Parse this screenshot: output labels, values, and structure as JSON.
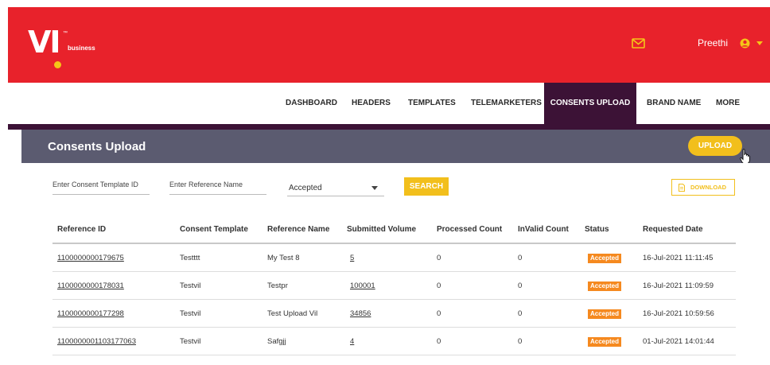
{
  "brand": {
    "mark": "VI",
    "tm": "™",
    "sub": "business"
  },
  "header": {
    "user_name": "Preethi",
    "mail_icon": "mail-icon",
    "user_icon": "user-circle-icon",
    "accent": "#f5c518",
    "bg": "#e8222b"
  },
  "nav": {
    "items": [
      {
        "label": "DASHBOARD"
      },
      {
        "label": "HEADERS"
      },
      {
        "label": "TEMPLATES"
      },
      {
        "label": "TELEMARKETERS"
      },
      {
        "label": "CONSENTS UPLOAD",
        "active": true
      },
      {
        "label": "BRAND NAME"
      },
      {
        "label": "MORE"
      }
    ],
    "active_color": "#3c1236"
  },
  "page": {
    "title": "Consents Upload",
    "upload_label": "UPLOAD"
  },
  "filters": {
    "template_placeholder": "Enter Consent Template ID",
    "reference_placeholder": "Enter Reference Name",
    "status_selected": "Accepted",
    "search_label": "SEARCH",
    "download_label": "DOWNLOAD"
  },
  "table": {
    "columns": [
      "Reference ID",
      "Consent Template",
      "Reference Name",
      "Submitted Volume",
      "Processed Count",
      "InValid Count",
      "Status",
      "Requested Date"
    ],
    "rows": [
      {
        "ref_id": "1100000000179675",
        "template": "Testttt",
        "ref_name": "My Test 8",
        "submitted": "5",
        "processed": "0",
        "invalid": "0",
        "status": "Accepted",
        "date": "16-Jul-2021 11:11:45"
      },
      {
        "ref_id": "1100000000178031",
        "template": "Testvil",
        "ref_name": "Testpr",
        "submitted": "100001",
        "processed": "0",
        "invalid": "0",
        "status": "Accepted",
        "date": "16-Jul-2021 11:09:59"
      },
      {
        "ref_id": "1100000000177298",
        "template": "Testvil",
        "ref_name": "Test Upload Vil",
        "submitted": "34856",
        "processed": "0",
        "invalid": "0",
        "status": "Accepted",
        "date": "16-Jul-2021 10:59:56"
      },
      {
        "ref_id": "1100000001103177063",
        "template": "Testvil",
        "ref_name": "Safgjj",
        "submitted": "4",
        "processed": "0",
        "invalid": "0",
        "status": "Accepted",
        "date": "01-Jul-2021 14:01:44"
      }
    ],
    "status_color": "#f5891f"
  }
}
